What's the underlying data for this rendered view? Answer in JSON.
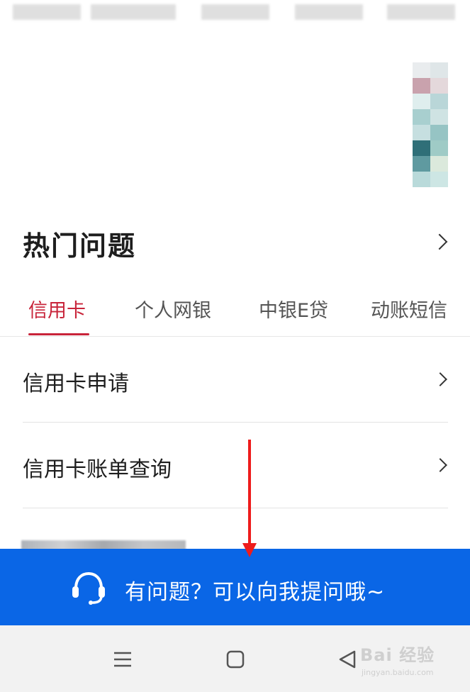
{
  "hot_questions": {
    "title": "热门问题"
  },
  "tabs": [
    {
      "label": "信用卡",
      "active": true
    },
    {
      "label": "个人网银",
      "active": false
    },
    {
      "label": "中银E贷",
      "active": false
    },
    {
      "label": "动账短信",
      "active": false
    }
  ],
  "questions": [
    {
      "label": "信用卡申请"
    },
    {
      "label": "信用卡账单查询"
    }
  ],
  "help_bar": {
    "text": "有问题？可以向我提问哦~"
  },
  "watermark": {
    "main": "Bai 经验",
    "sub": "jingyan.baidu.com"
  },
  "colors": {
    "accent_red": "#c8243a",
    "help_blue": "#0a66e6",
    "annotation_arrow": "#ee1c1c",
    "nav_background": "#f2f2f2"
  },
  "icons": {
    "more": "chevron-right-icon",
    "help": "headset-icon",
    "nav": [
      "menu-icon",
      "home-icon",
      "back-icon"
    ]
  }
}
